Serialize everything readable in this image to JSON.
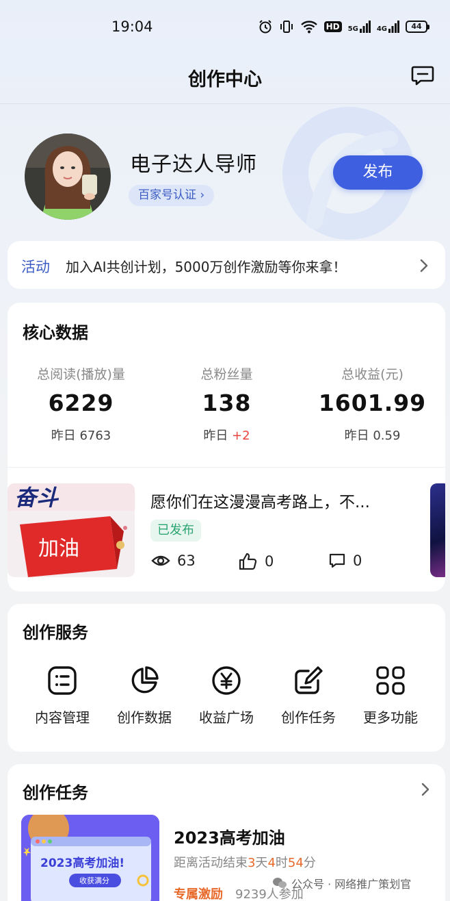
{
  "status_bar": {
    "time": "19:04",
    "network_5g": "5G",
    "network_4g": "4G",
    "hd": "HD",
    "battery": "44"
  },
  "nav": {
    "title": "创作中心"
  },
  "profile": {
    "name": "电子达人导师",
    "cert_label": "百家号认证 ›",
    "publish_label": "发布"
  },
  "activity": {
    "tag": "活动",
    "text": "加入AI共创计划，5000万创作激励等你来拿！"
  },
  "core_data": {
    "title": "核心数据",
    "stats": [
      {
        "label": "总阅读(播放)量",
        "value": "6229",
        "yesterday_label": "昨日",
        "yesterday_value": "6763",
        "delta": ""
      },
      {
        "label": "总粉丝量",
        "value": "138",
        "yesterday_label": "昨日",
        "yesterday_value": "",
        "delta": "+2"
      },
      {
        "label": "总收益(元)",
        "value": "1601.99",
        "yesterday_label": "昨日",
        "yesterday_value": "0.59",
        "delta": ""
      }
    ],
    "article": {
      "title": "愿你们在这漫漫高考路上，不...",
      "status": "已发布",
      "views": "63",
      "likes": "0",
      "comments": "0",
      "thumb_text_top": "奋斗",
      "thumb_text_flag": "加油"
    }
  },
  "services": {
    "title": "创作服务",
    "items": [
      {
        "label": "内容管理",
        "icon": "list-icon"
      },
      {
        "label": "创作数据",
        "icon": "pie-chart-icon"
      },
      {
        "label": "收益广场",
        "icon": "yen-icon"
      },
      {
        "label": "创作任务",
        "icon": "edit-icon"
      },
      {
        "label": "更多功能",
        "icon": "grid-icon"
      }
    ]
  },
  "tasks": {
    "title": "创作任务",
    "item": {
      "title": "2023高考加油",
      "countdown_prefix": "距离活动结束",
      "days": "3",
      "days_unit": "天",
      "hours": "4",
      "hours_unit": "时",
      "minutes": "54",
      "minutes_unit": "分",
      "reward": "专属激励",
      "participants": "9239人参加",
      "thumb_title": "2023高考加油!",
      "thumb_btn": "收获满分"
    }
  },
  "watermark": {
    "text": "公众号 · 网络推广策划官"
  }
}
